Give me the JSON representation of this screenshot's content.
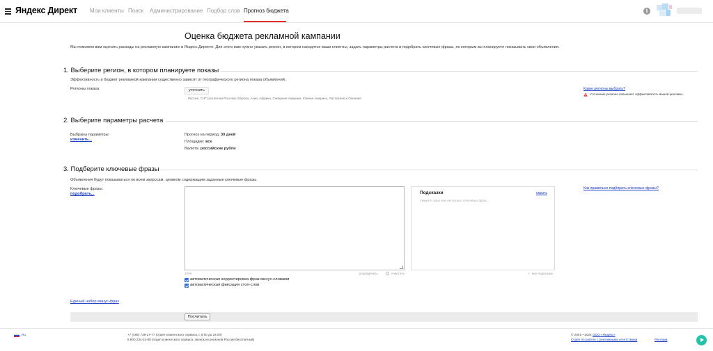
{
  "header": {
    "logo": "Яндекс Директ",
    "nav": [
      {
        "label": "Мои клиенты",
        "active": false
      },
      {
        "label": "Поиск",
        "active": false
      },
      {
        "label": "Администрирование",
        "active": false
      },
      {
        "label": "Подбор слов",
        "active": false
      },
      {
        "label": "Прогноз бюджета",
        "active": true
      }
    ],
    "icons": {
      "menu": "burger-menu-icon",
      "info": "info-icon"
    },
    "accent_color": "#e52d2d"
  },
  "page": {
    "title": "Оценка бюджета рекламной кампании",
    "intro": "Мы поможем вам оценить расходы на рекламную кампанию в Яндекс.Директе. Для этого вам нужно указать регион, в котором находятся ваши клиенты, задать параметры расчета и подобрать ключевые фразы, по которым вы планируете показывать свои объявления."
  },
  "section1": {
    "heading": "1. Выберите регион, в котором планируете показы",
    "description": "Эффективность и бюджет рекламной кампании существенно зависят от географического региона показа объявлений.",
    "regions_label": "Регионы показа:",
    "clarify_button": "уточнить",
    "regions_list": "Россия, СНГ (исключая Россию), Европа, Азия, Африка, Северная Америка, Южная Америка, Австралия и Океания",
    "help_link": "Какие регионы выбрать?",
    "warning": "Уточнение региона повышает эффективность вашей рекламы."
  },
  "section2": {
    "heading": "2. Выберите параметры расчета",
    "params_label": "Выбраны параметры:",
    "change_link": "изменить...",
    "period_label": "Прогноз на период:",
    "period_value": "30 дней",
    "platforms_label": "Площадки:",
    "platforms_value": "все",
    "currency_label": "Валюта:",
    "currency_value": "российские рубли"
  },
  "section3": {
    "heading": "3. Подберите ключевые фразы",
    "description": "Объявления будут показываться по всем запросам, целиком содержащим заданные ключевые фразы.",
    "keywords_label": "Ключевые фразы:",
    "pick_link": "подобрать...",
    "keywords_value": "",
    "hints_title": "Подсказки",
    "hints_hide": "скрыть",
    "hints_placeholder": "Укажите одну или несколько ключевых фраз...",
    "howto_link": "Как правильно подбирать ключевые фразы?",
    "counter": "4096",
    "order_link": "упорядочить",
    "clear_link": "очистить",
    "all_hints_link": "все подсказки",
    "checkbox_autocorrect": {
      "label": "автоматическая корректировка фраз минус-словами",
      "checked": true
    },
    "checkbox_stopwords": {
      "label": "автоматическая фиксация стоп-слов",
      "checked": true
    },
    "minus_phrases_link": "Единый набор минус-фраз",
    "calculate_button": "Посчитать"
  },
  "footer": {
    "lang": "Ru",
    "phone1": "+7 (495) 739-37-77 (отдел клиентского сервиса, с 8:00 до 24:00)",
    "phone2": "8 800 234-24-80 (отдел клиентского сервиса, звонок из регионов России бесплатный)",
    "copyright_prefix": "© 2001—2024",
    "company_link": "ООО «Яндекс»",
    "agencies_link": "Отдел по работе с рекламными агентствами",
    "ads_link": "Реклама",
    "support_color": "#23c3a9"
  }
}
